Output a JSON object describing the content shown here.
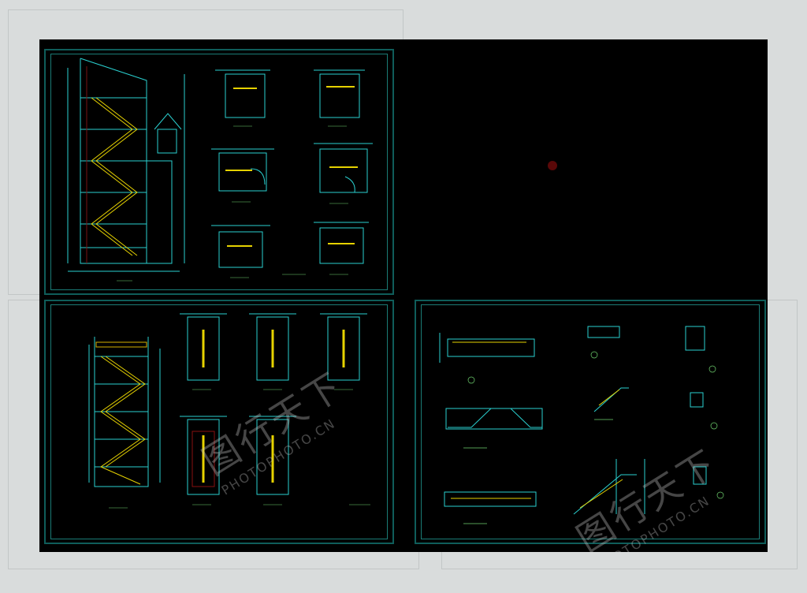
{
  "window": {
    "title": ""
  },
  "viewport": {
    "background": "#000000",
    "frame_color": "#1b7c76",
    "line_color": "#2ad0d0",
    "accent_yellow": "#e6d200",
    "text_green": "#6fd36f",
    "dim_red": "#8a1010"
  },
  "watermarks": [
    {
      "main": "图行天下",
      "sub": "PHOTOPHOTO.CN"
    },
    {
      "main": "图行天下",
      "sub": "PHOTOPHOTO.CN"
    }
  ],
  "sheets": [
    {
      "name": "sheet-top-left",
      "content": "stair sections and floor plans"
    },
    {
      "name": "sheet-bottom-left",
      "content": "stair section and plans"
    },
    {
      "name": "sheet-bottom-right",
      "content": "stair construction details"
    }
  ]
}
